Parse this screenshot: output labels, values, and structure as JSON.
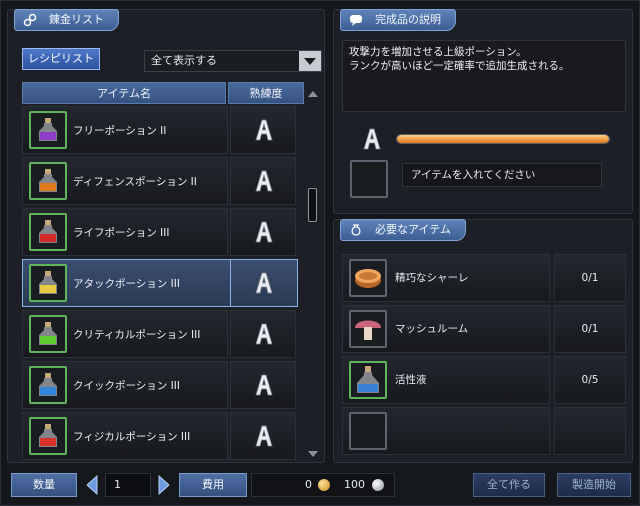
{
  "left_panel": {
    "title": "錬金リスト",
    "title_icon": "link-icon",
    "recipe_button": "レシピリスト",
    "filter": "全て表示する",
    "columns": {
      "name": "アイテム名",
      "proficiency": "熟練度"
    },
    "items": [
      {
        "name": "フリーポーション II",
        "grade": "A",
        "potion_color": "#8a3fc6"
      },
      {
        "name": "ディフェンスポーション II",
        "grade": "A",
        "potion_color": "#e07a1f"
      },
      {
        "name": "ライフポーション III",
        "grade": "A",
        "potion_color": "#d22a2a"
      },
      {
        "name": "アタックポーション III",
        "grade": "A",
        "potion_color": "#e8c840"
      },
      {
        "name": "クリティカルポーション III",
        "grade": "A",
        "potion_color": "#5ecb2e"
      },
      {
        "name": "クイックポーション III",
        "grade": "A",
        "potion_color": "#2f86d8"
      },
      {
        "name": "フィジカルポーション III",
        "grade": "A",
        "potion_color": "#d8342c"
      }
    ],
    "selected_index": 3
  },
  "description_panel": {
    "title": "完成品の説明",
    "lines": [
      "攻撃力を増加させる上級ポーション。",
      "ランクが高いほど一定確率で追加生成される。"
    ],
    "grade": "A",
    "progress": 1.0,
    "slot_hint": "アイテムを入れてください"
  },
  "required_panel": {
    "title": "必要なアイテム",
    "items": [
      {
        "name": "精巧なシャーレ",
        "count": "0/1",
        "icon": "petri-dish-icon"
      },
      {
        "name": "マッシュルーム",
        "count": "0/1",
        "icon": "mushroom-icon"
      },
      {
        "name": "活性液",
        "count": "0/5",
        "icon": "blue-flask-icon"
      },
      {
        "name": "",
        "count": "",
        "icon": ""
      }
    ]
  },
  "bottom_bar": {
    "quantity_label": "数量",
    "quantity": "1",
    "fee_label": "費用",
    "gold": "0",
    "silver": "100",
    "make_all": "全て作る",
    "start": "製造開始"
  }
}
